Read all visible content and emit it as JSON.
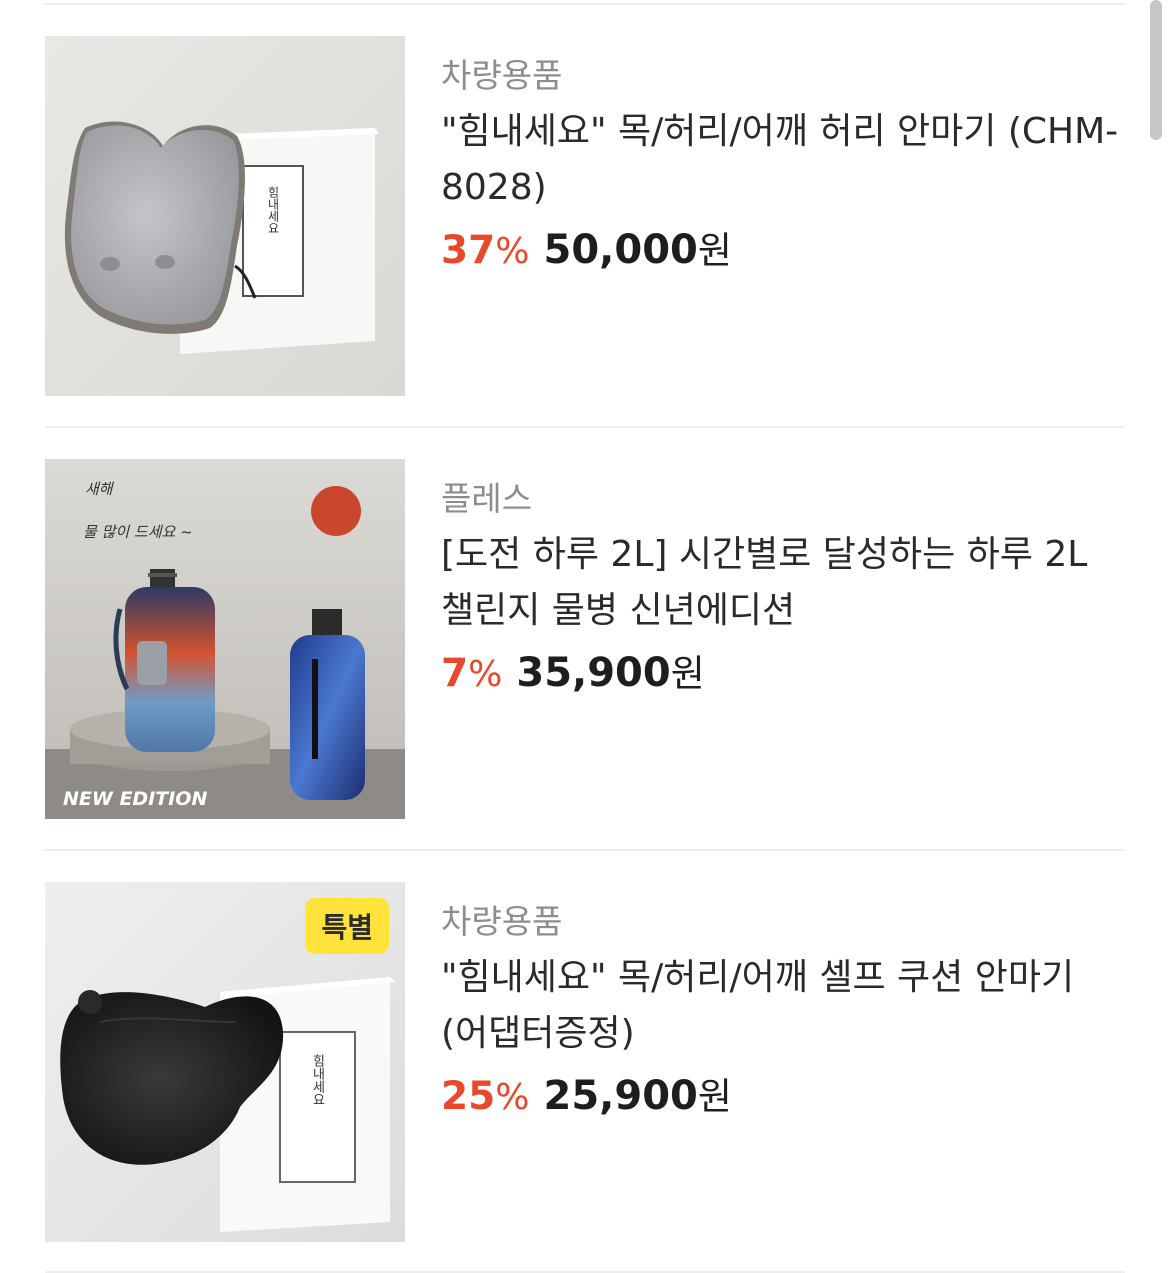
{
  "products": [
    {
      "category": "차량용품",
      "title": "\"힘내세요\" 목/허리/어깨 허리 안마기 (CHM-8028)",
      "discount": "37",
      "percent_sign": "%",
      "price": "50,000",
      "currency": "원",
      "image_icon": "lumbar-massager-image",
      "box_text": "힘내세요"
    },
    {
      "category": "플레스",
      "title": "[도전 하루 2L] 시간별로 달성하는 하루 2L 챌린지 물병 신년에디션",
      "discount": "7",
      "percent_sign": "%",
      "price": "35,900",
      "currency": "원",
      "image_icon": "water-bottle-image",
      "image_text_1": "새해",
      "image_text_2": "물 많이 드세요 ~",
      "image_text_3": "NEW EDITION"
    },
    {
      "category": "차량용품",
      "title": "\"힘내세요\" 목/허리/어깨 셀프 쿠션 안마기 (어댑터증정)",
      "discount": "25",
      "percent_sign": "%",
      "price": "25,900",
      "currency": "원",
      "badge": "특별",
      "image_icon": "cushion-massager-image",
      "box_text": "힘내세요"
    }
  ],
  "colors": {
    "discount": "#e8482c",
    "badge": "#ffe23a",
    "category": "#8d8d8d"
  }
}
